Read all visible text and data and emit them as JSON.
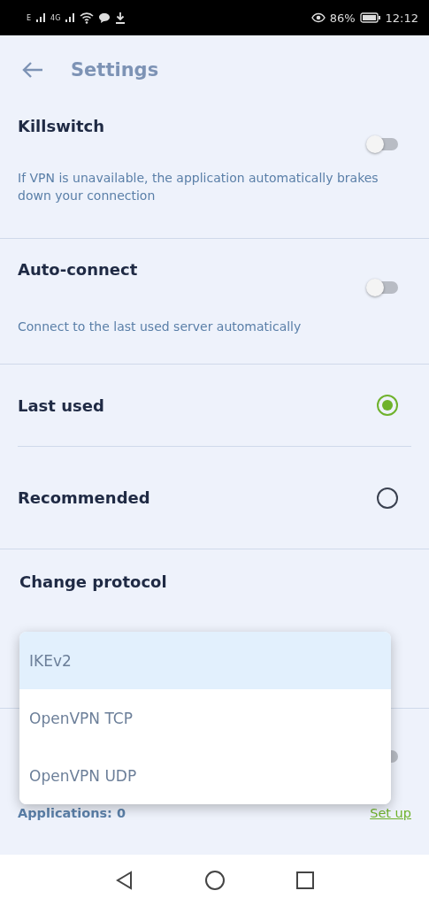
{
  "status_bar": {
    "network_1": "E",
    "network_2": "4G",
    "battery": "86%",
    "time": "12:12"
  },
  "header": {
    "title": "Settings"
  },
  "toggles": [
    {
      "title": "Killswitch",
      "on": false,
      "description": "If VPN is unavailable, the application automatically brakes down your connection"
    },
    {
      "title": "Auto-connect",
      "on": false,
      "description": "Connect to the last used server automatically"
    }
  ],
  "connect_options": [
    {
      "label": "Last used",
      "selected": true
    },
    {
      "label": "Recommended",
      "selected": false
    }
  ],
  "protocol": {
    "title": "Change protocol",
    "options": [
      {
        "label": "IKEv2",
        "selected": true
      },
      {
        "label": "OpenVPN TCP",
        "selected": false
      },
      {
        "label": "OpenVPN UDP",
        "selected": false
      }
    ]
  },
  "split_tunneling": {
    "on": false,
    "count": "Applications: 0",
    "action": "Set up"
  }
}
